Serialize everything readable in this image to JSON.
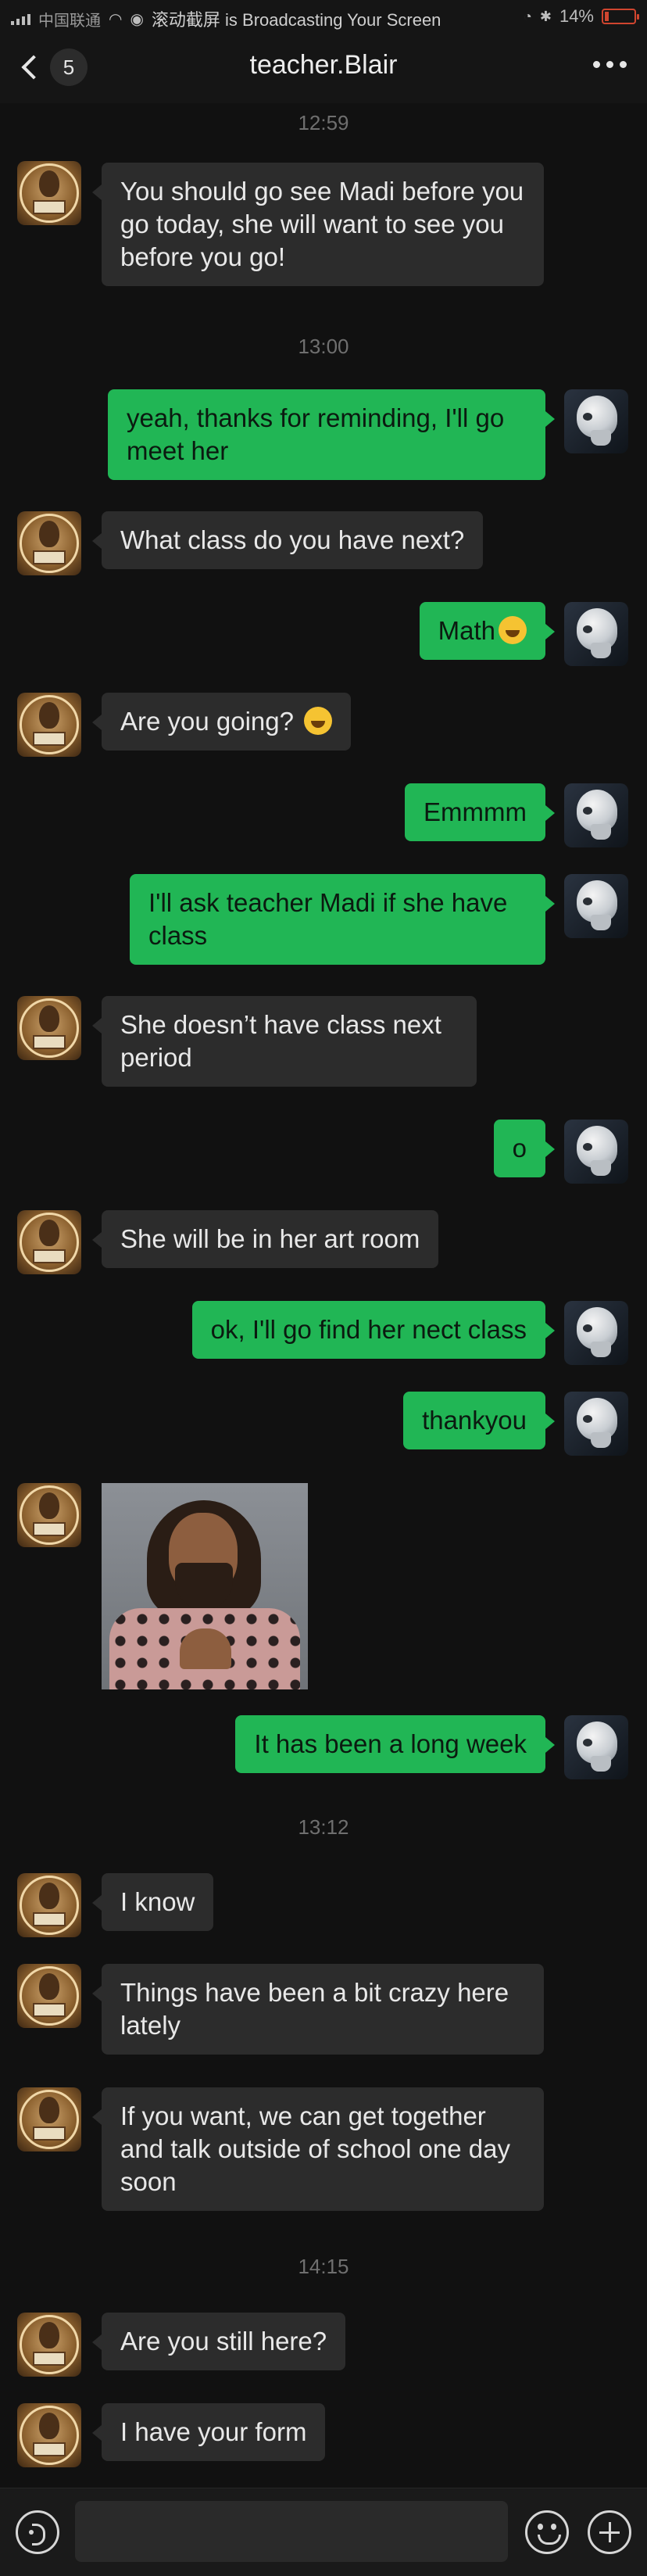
{
  "status_bar": {
    "carrier": "中国联通",
    "broadcast_text": "滚动截屏 is Broadcasting Your Screen",
    "battery": "14%",
    "battery_level": 0.14,
    "battery_color": "#d0452f"
  },
  "nav": {
    "unread_count": "5",
    "title": "teacher.Blair",
    "back_icon": "chevron-left-icon",
    "more_icon": "more-dots-icon"
  },
  "timestamps": [
    "12:59",
    "13:00",
    "13:12",
    "14:15"
  ],
  "messages": [
    {
      "sender": "teacher",
      "text": "You should go see Madi before you go today, she will want to see you before you go!"
    },
    {
      "sender": "me",
      "text": "yeah, thanks for reminding, I'll go meet her"
    },
    {
      "sender": "teacher",
      "text": "What class do you have next?"
    },
    {
      "sender": "me",
      "text": "Math",
      "emoji": "laughing-tears-emoji"
    },
    {
      "sender": "teacher",
      "text": "Are you going?",
      "emoji": "rolling-laughing-emoji"
    },
    {
      "sender": "me",
      "text": "Emmmm"
    },
    {
      "sender": "me",
      "text": "I'll ask teacher Madi if she have class"
    },
    {
      "sender": "teacher",
      "text": "She doesn’t have class next period"
    },
    {
      "sender": "me",
      "text": "o"
    },
    {
      "sender": "teacher",
      "text": "She will be in her art room"
    },
    {
      "sender": "me",
      "text": "ok, I'll go find her nect class"
    },
    {
      "sender": "me",
      "text": "thankyou"
    },
    {
      "sender": "teacher",
      "type": "image",
      "image": "man-making-heart-hands-photo"
    },
    {
      "sender": "me",
      "text": "It has been a long week"
    },
    {
      "sender": "teacher",
      "text": "I know"
    },
    {
      "sender": "teacher",
      "text": "Things have been a bit crazy here lately"
    },
    {
      "sender": "teacher",
      "text": "If you want, we can get together and talk outside of school one day soon"
    },
    {
      "sender": "teacher",
      "text": "Are you still here?"
    },
    {
      "sender": "teacher",
      "text": "I have your form"
    }
  ],
  "input_bar": {
    "voice_icon": "voice-icon",
    "emoji_icon": "emoji-icon",
    "plus_icon": "plus-icon",
    "placeholder": ""
  },
  "colors": {
    "background": "#111111",
    "incoming_bubble": "#2c2c2c",
    "outgoing_bubble": "#21b655",
    "timestamp": "#6f6f6f"
  }
}
